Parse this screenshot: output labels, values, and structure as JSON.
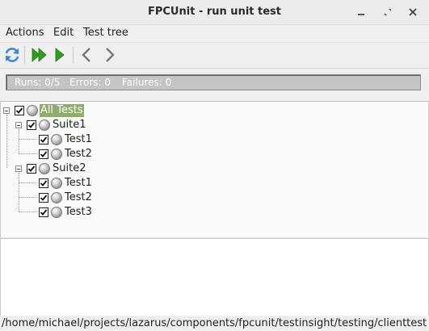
{
  "window": {
    "title": "FPCUnit - run unit test"
  },
  "menu": {
    "items": [
      "Actions",
      "Edit",
      "Test tree"
    ]
  },
  "toolbar": {
    "icons": [
      "refresh-icon",
      "run-all-icon",
      "run-icon",
      "back-icon",
      "forward-icon"
    ]
  },
  "status": {
    "runs": "Runs: 0/5",
    "errors": "Errors: 0",
    "failures": "Failures: 0"
  },
  "tree": {
    "root": "All Tests",
    "suites": [
      {
        "label": "Suite1",
        "tests": [
          "Test1",
          "Test2"
        ]
      },
      {
        "label": "Suite2",
        "tests": [
          "Test1",
          "Test2",
          "Test3"
        ]
      }
    ]
  },
  "statusbar": {
    "path": "/home/michael/projects/lazarus/components/fpcunit/testinsight/testing/clienttest"
  },
  "colors": {
    "selection": "#8ead6a",
    "run_green": "#2f9e1f",
    "refresh_blue": "#3a86d6"
  }
}
